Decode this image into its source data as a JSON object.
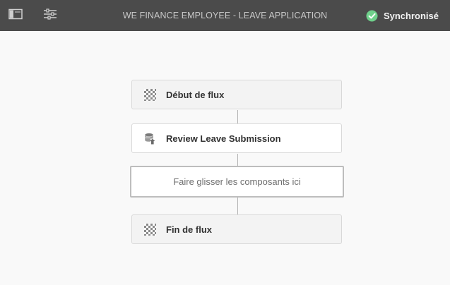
{
  "header": {
    "title": "WE FINANCE EMPLOYEE - LEAVE APPLICATION",
    "status": {
      "label": "Synchronisé",
      "color": "#6fd08b"
    },
    "buttons": [
      {
        "icon": "side-panel-icon"
      },
      {
        "icon": "properties-sliders-icon"
      }
    ]
  },
  "flow": {
    "start": {
      "label": "Début de flux",
      "icon": "flow-start-checker-icon"
    },
    "step": {
      "label": "Review Leave Submission",
      "icon": "participant-step-icon"
    },
    "dropzone": {
      "label": "Faire glisser les composants ici"
    },
    "end": {
      "label": "Fin de flux",
      "icon": "flow-end-checker-icon"
    }
  }
}
